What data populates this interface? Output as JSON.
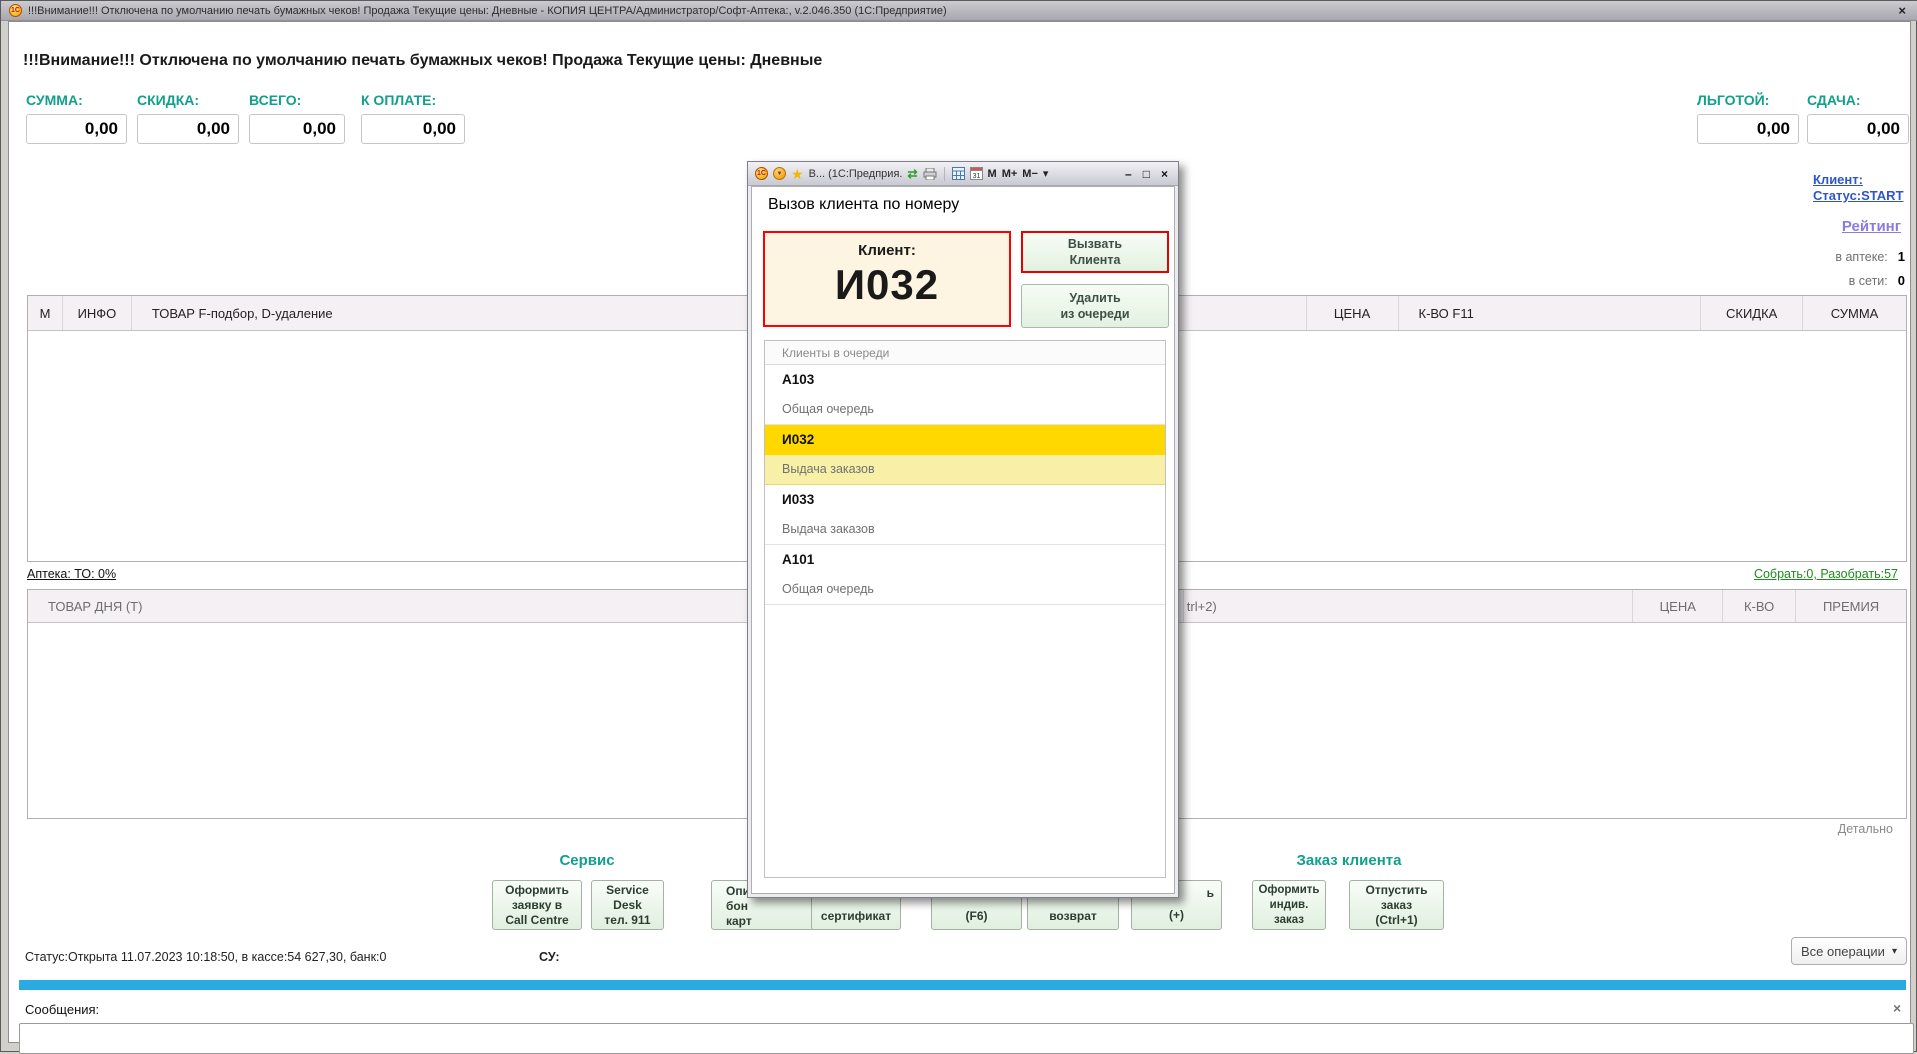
{
  "colors": {
    "accent_teal": "#12a08d",
    "selected_yellow": "#ffd800",
    "selected_yellow_pale": "#f9f0a8",
    "link_blue": "#2f55cc",
    "rating_purple": "#8a7cdc",
    "collect_green": "#1e8a1e",
    "alert_red": "#ff0000",
    "bottom_bar_blue": "#29abe2"
  },
  "window": {
    "app_icon_text": "1С",
    "title": "!!!Внимание!!! Отключена по умолчанию печать бумажных чеков! Продажа Текущие цены: Дневные - КОПИЯ ЦЕНТРА/Администратор/Софт-Аптека:, v.2.046.350  (1С:Предприятие)",
    "close_icon": "×"
  },
  "warning": "!!!Внимание!!! Отключена по умолчанию печать бумажных чеков! Продажа Текущие цены: Дневные",
  "totals": {
    "left": [
      {
        "label": "СУММА:",
        "value": "0,00"
      },
      {
        "label": "СКИДКА:",
        "value": "0,00"
      },
      {
        "label": "ВСЕГО:",
        "value": "0,00"
      },
      {
        "label": "К ОПЛАТЕ:",
        "value": "0,00"
      }
    ],
    "right": [
      {
        "label": "ЛЬГОТОЙ:",
        "value": "0,00"
      },
      {
        "label": "СДАЧА:",
        "value": "0,00"
      }
    ]
  },
  "client_panel": {
    "client_link": "Клиент:",
    "status_link": "Статус:START",
    "rating_link": "Рейтинг",
    "in_pharmacy_label": "в аптеке:",
    "in_pharmacy_value": "1",
    "online_label": "в сети:",
    "online_value": "0"
  },
  "sales_table": {
    "columns": [
      "М",
      "ИНФО",
      "ТОВАР  F-подбор, D-удаление",
      "ЦЕНА",
      "К-ВО F11",
      "СКИДКА",
      "СУММА"
    ]
  },
  "links": {
    "pharmacy": "Аптека: ТО: 0%",
    "collect": "Собрать:0, Разобрать:57",
    "detail": "Детально"
  },
  "day_table": {
    "columns": [
      "ТОВАР ДНЯ (Т)",
      "trl+2)",
      "ЦЕНА",
      "К-ВО",
      "ПРЕМИЯ"
    ]
  },
  "service_section": {
    "title": "Сервис",
    "buttons": [
      {
        "lines": [
          "Оформить",
          "заявку в",
          "Call Centre"
        ]
      },
      {
        "lines": [
          "Service",
          "Desk",
          "тел. 911"
        ]
      },
      {
        "lines": [
          "Опи",
          "бон",
          "карт"
        ]
      },
      {
        "lines": [
          "сертификат"
        ]
      },
      {
        "lines": [
          "(F6)"
        ]
      },
      {
        "lines": [
          "возврат"
        ]
      },
      {
        "lines": [
          "ь",
          "(+)"
        ]
      }
    ]
  },
  "order_section": {
    "title": "Заказ клиента",
    "buttons": [
      {
        "lines": [
          "Оформить",
          "индив.",
          "заказ"
        ]
      },
      {
        "lines": [
          "Отпустить",
          "заказ",
          "(Ctrl+1)"
        ]
      }
    ]
  },
  "statusbar": {
    "status": "Статус:Открыта 11.07.2023 10:18:50, в кассе:54 627,30, банк:0",
    "su_label": "СУ:",
    "all_operations_label": "Все операции",
    "dropdown_icon": "▾"
  },
  "messages": {
    "label": "Сообщения:",
    "close_icon": "×",
    "input_value": ""
  },
  "dialog": {
    "titlebar": {
      "app_icon_text": "1С",
      "dropdown_icon": "▼",
      "star_icon": "★",
      "title": "В... (1С:Предприя.",
      "sync_icon": "⇄",
      "calendar_day": "31",
      "m": "M",
      "m_plus": "M+",
      "m_minus": "M−",
      "chevron_icon": "▾",
      "minimize_icon": "–",
      "maximize_icon": "□",
      "close_icon": "×"
    },
    "heading": "Вызов клиента по номеру",
    "client_box": {
      "label": "Клиент:",
      "number": "И032"
    },
    "call_button": {
      "lines": [
        "Вызвать",
        "Клиента"
      ]
    },
    "remove_button": {
      "lines": [
        "Удалить",
        "из очереди"
      ]
    },
    "queue_header": "Клиенты в очереди",
    "queue": [
      {
        "code": "А103",
        "type": "Общая очередь"
      },
      {
        "code": "И032",
        "type": "Выдача заказов"
      },
      {
        "code": "И033",
        "type": "Выдача заказов"
      },
      {
        "code": "А101",
        "type": "Общая очередь"
      }
    ]
  }
}
